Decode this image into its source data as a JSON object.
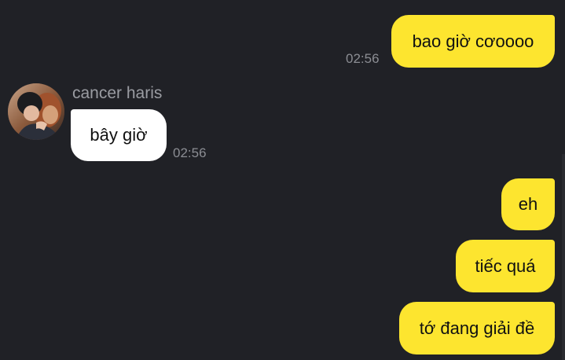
{
  "conversation": {
    "contact": {
      "name": "cancer haris",
      "avatar_icon": "profile-photo-icon"
    },
    "messages": [
      {
        "direction": "outgoing",
        "text": "bao giờ cơoooo",
        "time": "02:56"
      },
      {
        "direction": "incoming",
        "text": "bây giờ",
        "time": "02:56"
      },
      {
        "direction": "outgoing",
        "text": "eh"
      },
      {
        "direction": "outgoing",
        "text": "tiếc quá"
      },
      {
        "direction": "outgoing",
        "text": "tớ đang giải đề"
      }
    ]
  },
  "colors": {
    "background": "#202126",
    "outgoing_bubble": "#fde52f",
    "incoming_bubble": "#ffffff",
    "timestamp": "#8b8d93"
  }
}
